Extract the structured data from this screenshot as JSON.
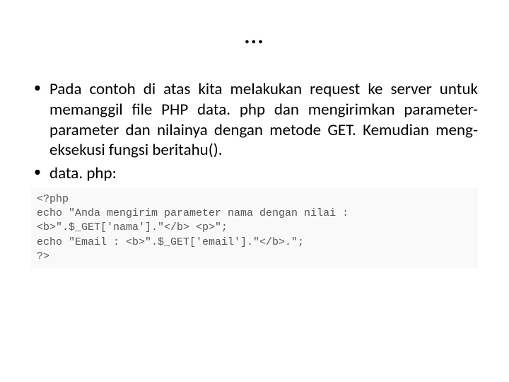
{
  "title": "…",
  "bullets": [
    "Pada contoh di atas kita melakukan request ke server untuk memanggil file PHP data. php dan mengirimkan parameter-parameter dan nilainya dengan metode GET. Kemudian meng-eksekusi fungsi beritahu().",
    "data. php:"
  ],
  "code": "<?php\necho \"Anda mengirim parameter nama dengan nilai :\n<b>\".$_GET['nama'].\"</b> <p>\";\necho \"Email : <b>\".$_GET['email'].\"</b>.\";\n?>"
}
